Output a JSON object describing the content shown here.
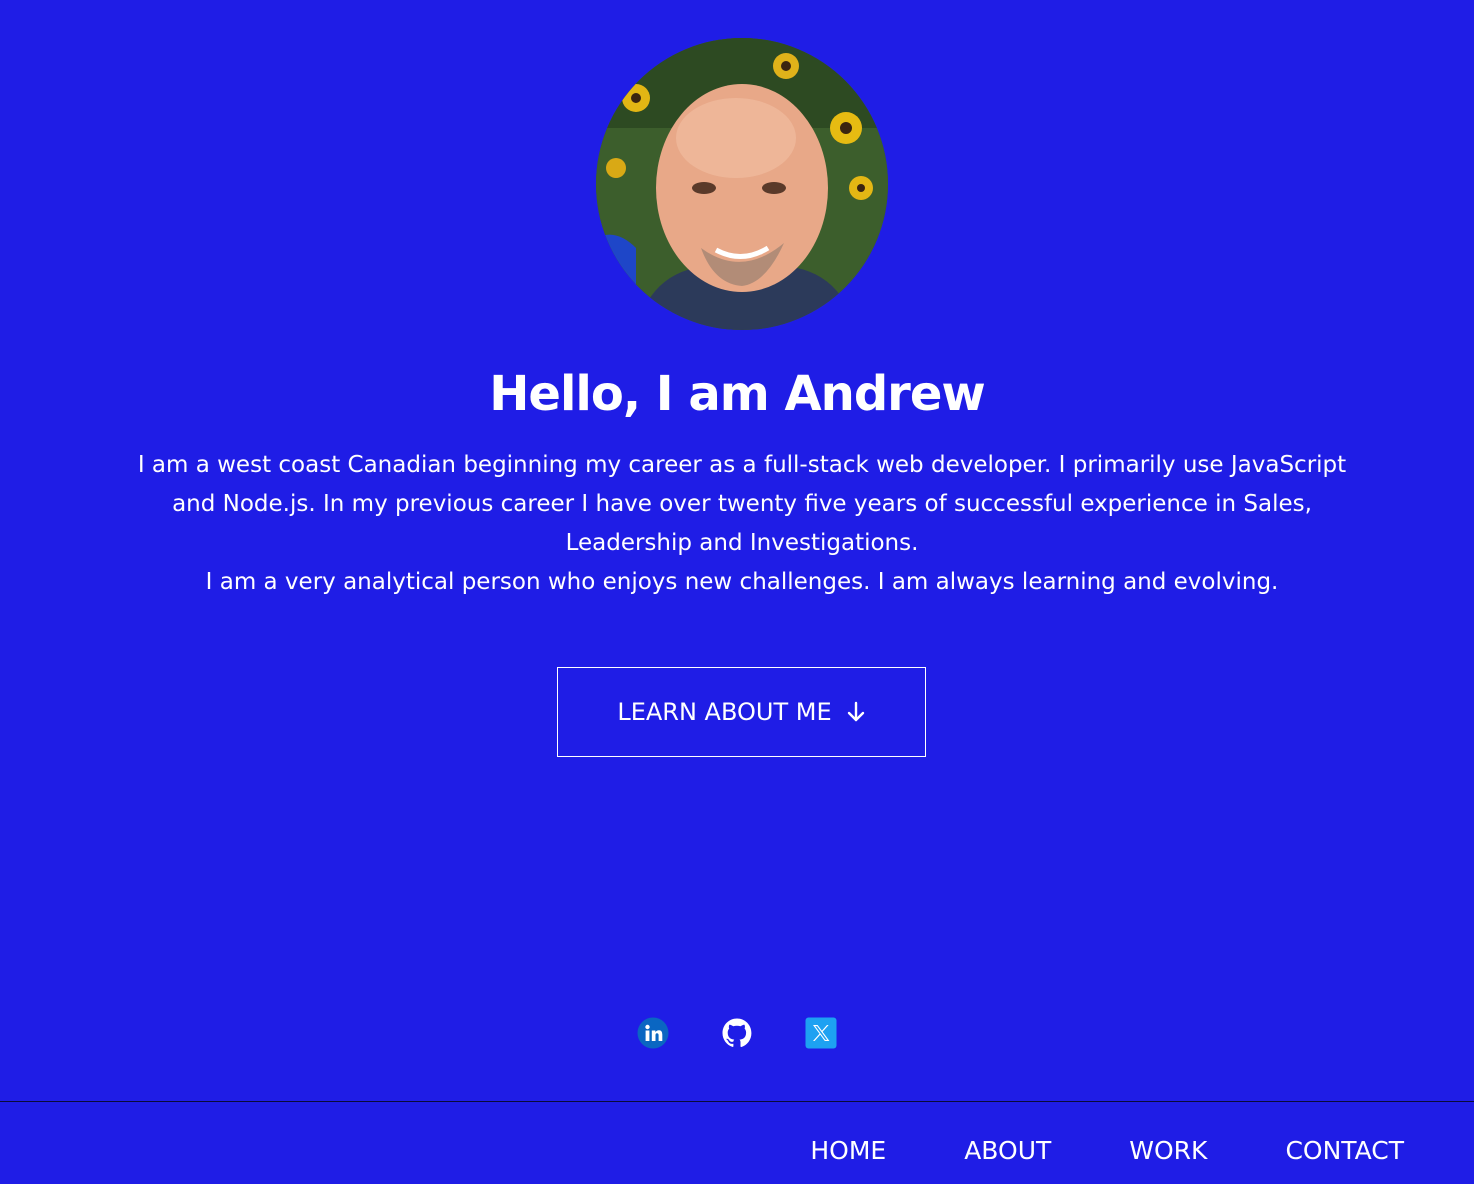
{
  "hero": {
    "avatar_alt": "Andrew",
    "title": "Hello, I am Andrew",
    "bio_paragraphs": [
      "I am a west coast Canadian beginning my career as a full-stack web developer. I primarily use JavaScript and Node.js. In my previous career I have over twenty five years of successful experience in Sales, Leadership and Investigations.",
      "I am a very analytical person who enjoys new challenges. I am always learning and evolving."
    ],
    "cta_label": "LEARN ABOUT ME",
    "cta_icon": "arrow-down-icon"
  },
  "socials": [
    {
      "name": "linkedin",
      "icon": "linkedin-icon",
      "color": "#0a66c2"
    },
    {
      "name": "github",
      "icon": "github-icon",
      "color": "#ffffff"
    },
    {
      "name": "x",
      "icon": "x-icon",
      "color": "#1da1f2"
    }
  ],
  "nav": {
    "items": [
      "HOME",
      "ABOUT",
      "WORK",
      "CONTACT"
    ]
  },
  "colors": {
    "background": "#1f1de6",
    "text": "#ffffff"
  }
}
